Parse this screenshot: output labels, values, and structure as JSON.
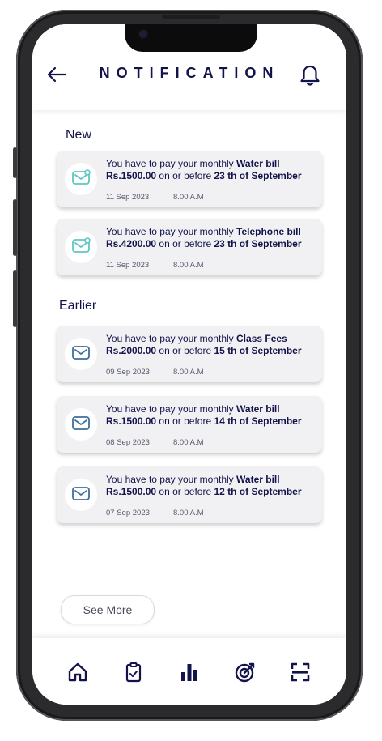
{
  "header": {
    "title": "NOTIFICATION"
  },
  "colors": {
    "primary": "#12134a",
    "accent_new": "#5cc7c4",
    "accent_earlier": "#3f6f9c",
    "card_bg": "#f1f1f3"
  },
  "sections": {
    "new_label": "New",
    "earlier_label": "Earlier"
  },
  "notifications": [
    {
      "prefix": "You  have to pay your monthly",
      "bill": "Water bill",
      "amount": "Rs.1500.00",
      "mid": "on or before",
      "due": "23 th of September",
      "date": "11 Sep 2023",
      "time": "8.00 A.M",
      "icon": "mail-unread-icon"
    },
    {
      "prefix": "You  have to pay your monthly",
      "bill": "Telephone bill",
      "amount": "Rs.4200.00",
      "mid": "on or before",
      "due": "23 th of September",
      "date": "11 Sep 2023",
      "time": "8.00 A.M",
      "icon": "mail-unread-icon"
    },
    {
      "prefix": "You  have to pay your monthly",
      "bill": "Class Fees",
      "amount": "Rs.2000.00",
      "mid": "on or before",
      "due": "15 th of September",
      "date": "09 Sep 2023",
      "time": "8.00 A.M",
      "icon": "mail-icon"
    },
    {
      "prefix": "You  have to pay your monthly",
      "bill": "Water bill",
      "amount": "Rs.1500.00",
      "mid": "on or before",
      "due": "14 th of September",
      "date": "08 Sep 2023",
      "time": "8.00 A.M",
      "icon": "mail-icon"
    },
    {
      "prefix": "You  have to pay your monthly",
      "bill": "Water bill",
      "amount": "Rs.1500.00",
      "mid": "on or before",
      "due": "12 th of September",
      "date": "07 Sep 2023",
      "time": "8.00 A.M",
      "icon": "mail-icon"
    }
  ],
  "see_more": "See More",
  "bottom_nav": [
    "home-icon",
    "clipboard-check-icon",
    "bar-chart-icon",
    "target-icon",
    "scan-icon"
  ]
}
